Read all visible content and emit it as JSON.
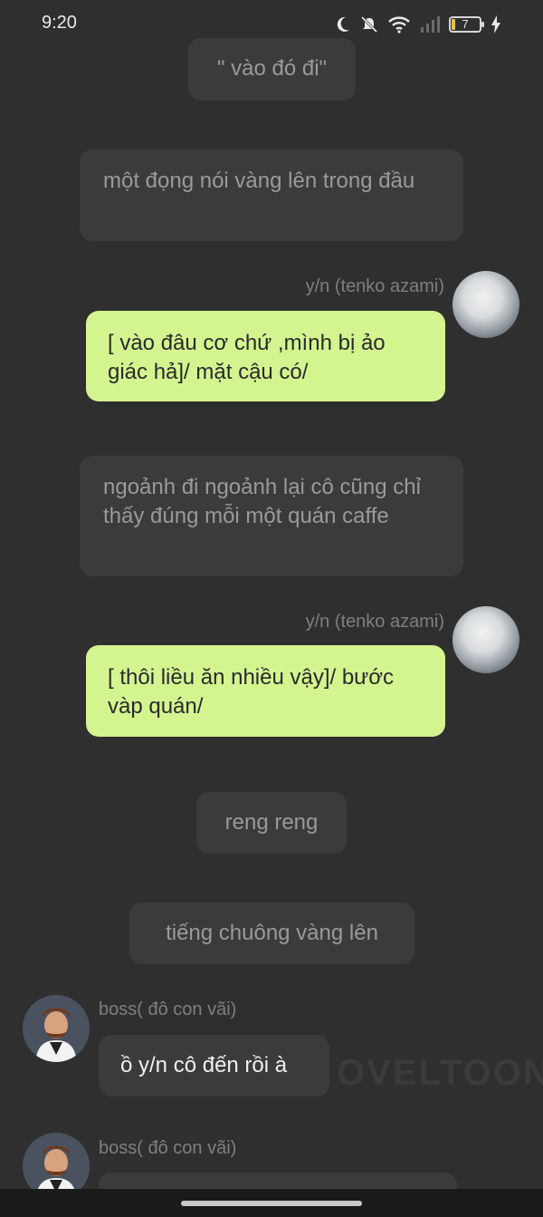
{
  "status": {
    "time": "9:20",
    "battery": "7"
  },
  "messages": {
    "n1": "\" vào đó đi\"",
    "n2": "một đọng nói vàng lên trong đầu",
    "u1_name": "y/n (tenko azami)",
    "u1_text": "[ vào đâu cơ chứ ,mình bị ảo giác hả]/ mặt cậu có/",
    "n3": "ngoảnh đi ngoảnh lại cô cũng chỉ thấy đúng mỗi một quán caffe",
    "u2_name": "y/n (tenko azami)",
    "u2_text": "[ thôi liều ăn nhiều vậy]/ bước vàp quán/",
    "n4": "reng reng",
    "n5": "tiếng chuông vàng lên",
    "b1_name": "boss( đô con vãi)",
    "b1_text": "ồ y/n cô đến rồi à",
    "b2_name": "boss( đô con vãi)"
  },
  "watermark": "OVELTOON",
  "colors": {
    "background": "#2f2f2f",
    "narration_bubble": "#3b3b3b",
    "user_bubble": "#d4f490"
  }
}
